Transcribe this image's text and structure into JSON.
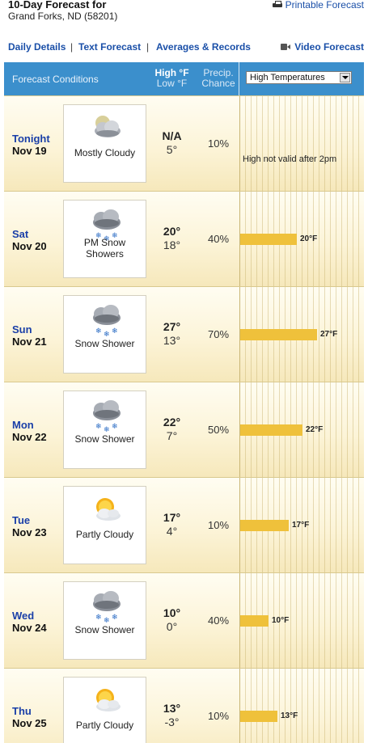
{
  "header": {
    "title": "10-Day Forecast for",
    "location": "Grand Forks, ND (58201)",
    "printable_label": "Printable Forecast"
  },
  "nav": {
    "daily_details": "Daily Details",
    "text_forecast": "Text Forecast",
    "averages_records": "Averages & Records",
    "separator": "|",
    "video_forecast": "Video Forecast"
  },
  "table_header": {
    "conditions": "Forecast Conditions",
    "high": "High °F",
    "low": "Low °F",
    "precip_line1": "Precip.",
    "precip_line2": "Chance",
    "graph_select": "High Temperatures"
  },
  "colors": {
    "header_bg": "#3b8fcc",
    "bar": "#efc13b",
    "link": "#1a4fa8"
  },
  "days": [
    {
      "day": "Tonight",
      "date": "Nov 19",
      "icon": "mostly-cloudy-night-icon",
      "condition_lines": [
        "Mostly Cloudy"
      ],
      "high": "N/A",
      "low": "5°",
      "precip": "10%",
      "bar_value": null,
      "bar_label": "",
      "note": "High not valid after 2pm"
    },
    {
      "day": "Sat",
      "date": "Nov 20",
      "icon": "snow-showers-icon",
      "condition_lines": [
        "PM Snow",
        "Showers"
      ],
      "high": "20°",
      "low": "18°",
      "precip": "40%",
      "bar_value": 20,
      "bar_label": "20°F",
      "note": ""
    },
    {
      "day": "Sun",
      "date": "Nov 21",
      "icon": "snow-shower-icon",
      "condition_lines": [
        "Snow Shower"
      ],
      "high": "27°",
      "low": "13°",
      "precip": "70%",
      "bar_value": 27,
      "bar_label": "27°F",
      "note": ""
    },
    {
      "day": "Mon",
      "date": "Nov 22",
      "icon": "snow-shower-icon",
      "condition_lines": [
        "Snow Shower"
      ],
      "high": "22°",
      "low": "7°",
      "precip": "50%",
      "bar_value": 22,
      "bar_label": "22°F",
      "note": ""
    },
    {
      "day": "Tue",
      "date": "Nov 23",
      "icon": "partly-cloudy-icon",
      "condition_lines": [
        "Partly Cloudy"
      ],
      "high": "17°",
      "low": "4°",
      "precip": "10%",
      "bar_value": 17,
      "bar_label": "17°F",
      "note": ""
    },
    {
      "day": "Wed",
      "date": "Nov 24",
      "icon": "snow-shower-icon",
      "condition_lines": [
        "Snow Shower"
      ],
      "high": "10°",
      "low": "0°",
      "precip": "40%",
      "bar_value": 10,
      "bar_label": "10°F",
      "note": ""
    },
    {
      "day": "Thu",
      "date": "Nov 25",
      "icon": "partly-cloudy-icon",
      "condition_lines": [
        "Partly Cloudy"
      ],
      "high": "13°",
      "low": "-3°",
      "precip": "10%",
      "bar_value": 13,
      "bar_label": "13°F",
      "note": ""
    }
  ]
}
